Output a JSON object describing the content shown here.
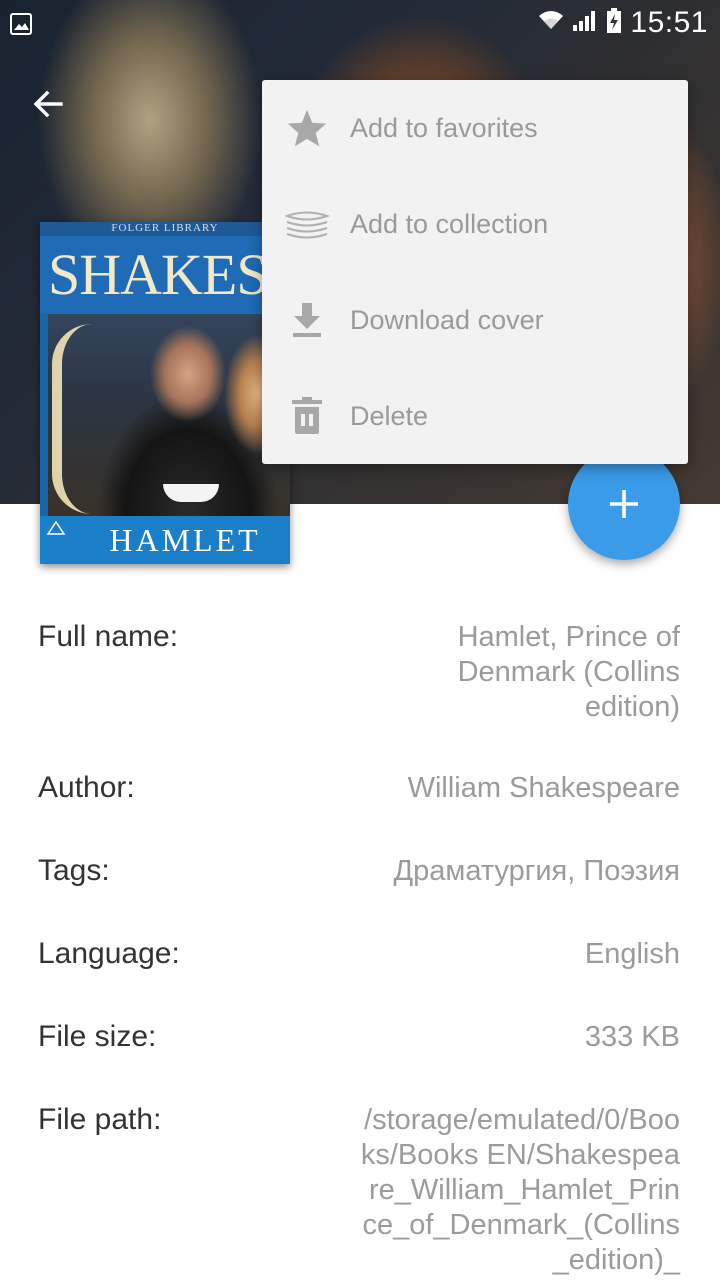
{
  "status_bar": {
    "time": "15:51"
  },
  "header": {
    "back_icon": "arrow-back-icon"
  },
  "cover": {
    "publisher_text": "FOLGER LIBRARY",
    "top_title": "SHAKESPEARE",
    "bottom_title": "HAMLET"
  },
  "menu": {
    "items": [
      {
        "label": "Add to favorites",
        "icon": "star-icon"
      },
      {
        "label": "Add to collection",
        "icon": "stack-icon"
      },
      {
        "label": "Download cover",
        "icon": "download-icon"
      },
      {
        "label": "Delete",
        "icon": "trash-icon"
      }
    ]
  },
  "fab": {
    "icon": "plus-icon"
  },
  "details": {
    "full_name": {
      "label": "Full name:",
      "value": "Hamlet, Prince of Denmark (Collins edition)"
    },
    "author": {
      "label": "Author:",
      "value": "William Shakespeare"
    },
    "tags": {
      "label": "Tags:",
      "value": "Драматургия, Поэзия"
    },
    "language": {
      "label": "Language:",
      "value": "English"
    },
    "file_size": {
      "label": "File size:",
      "value": "333 KB"
    },
    "file_path": {
      "label": "File path:",
      "value": "/storage/emulated/0/Books/Books EN/Shakespeare_William_Hamlet_Prince_of_Denmark_(Collins_edition)_"
    }
  },
  "colors": {
    "accent": "#3a9be8",
    "menu_text": "#9a9a9a",
    "label_text": "#333333",
    "value_text": "#9b9b9b"
  }
}
